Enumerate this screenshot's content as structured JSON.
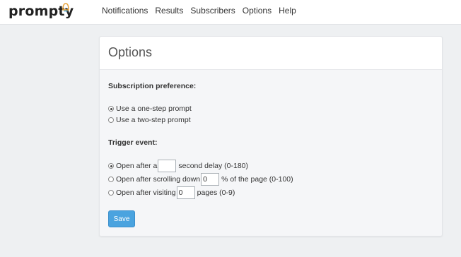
{
  "brand": {
    "name": "prompty",
    "logo_icon": "bell-icon",
    "logo_colors": [
      "#e8a33a",
      "#3aa0d8"
    ]
  },
  "nav": [
    {
      "label": "Notifications"
    },
    {
      "label": "Results"
    },
    {
      "label": "Subscribers"
    },
    {
      "label": "Options"
    },
    {
      "label": "Help"
    }
  ],
  "page": {
    "title": "Options"
  },
  "subscription": {
    "label": "Subscription preference:",
    "options": [
      {
        "label": "Use a one-step prompt",
        "selected": true
      },
      {
        "label": "Use a two-step prompt",
        "selected": false
      }
    ]
  },
  "trigger": {
    "label": "Trigger event:",
    "options": [
      {
        "before": "Open after a",
        "value": "",
        "after": "second delay (0-180)",
        "selected": true
      },
      {
        "before": "Open after scrolling down",
        "value": "0",
        "after": "% of the page (0-100)",
        "selected": false
      },
      {
        "before": "Open after visiting",
        "value": "0",
        "after": "pages (0-9)",
        "selected": false
      }
    ]
  },
  "actions": {
    "save_label": "Save"
  },
  "colors": {
    "accent": "#4aa3df",
    "background": "#eef0f2"
  }
}
